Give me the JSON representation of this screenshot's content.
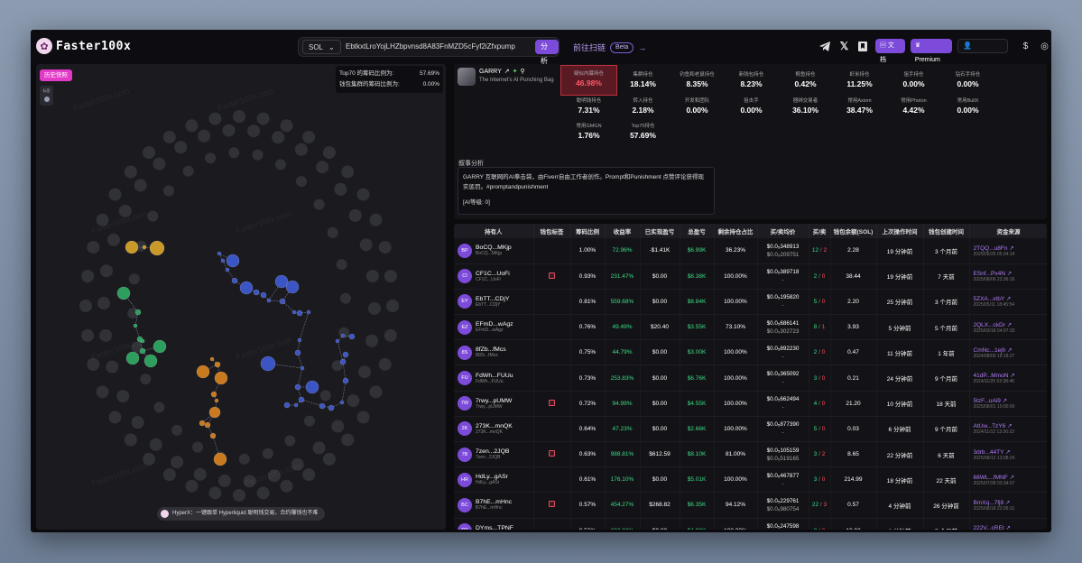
{
  "app": {
    "logo_text": "Faster100x"
  },
  "search": {
    "chain": "SOL",
    "address": "EbtkxtLroYojLHZbpvnsd8A83FnMZD5cFyf2iZfxpump",
    "analyze_label": "分析"
  },
  "scan": {
    "label": "前往扫链",
    "badge": "Beta",
    "arrow": "→"
  },
  "topbar": {
    "doc_label": "文档",
    "premium_label": "Premium"
  },
  "left": {
    "history_button": "历史快照",
    "side_chip_label": "标签",
    "top70_label": "Top70 的筹码比例为:",
    "top70_value": "57.69%",
    "wallet_cluster_label": "钱包集群的筹码比例为:",
    "wallet_cluster_value": "0.00%",
    "hyperx_text": "HyperX：一键跟单 Hyperliquid 聪明钱交易，合约赚钱也不难",
    "watermark": "Faster100x.com"
  },
  "token": {
    "name": "GARRY",
    "subtitle": "The Internet's AI Punching Bag"
  },
  "stats": [
    {
      "label": "疑似内幕持仓",
      "value": "46.98%"
    },
    {
      "label": "集群持仓",
      "value": "18.14%"
    },
    {
      "label": "钓鱼和老鼠持仓",
      "value": "8.35%"
    },
    {
      "label": "新钱包持仓",
      "value": "8.23%"
    },
    {
      "label": "鲸鱼持仓",
      "value": "0.42%"
    },
    {
      "label": "虾米持仓",
      "value": "11.25%"
    },
    {
      "label": "狙手持仓",
      "value": "0.00%"
    },
    {
      "label": "钻石手持仓",
      "value": "0.00%"
    },
    {
      "label": "聪明钱持仓",
      "value": "7.31%"
    },
    {
      "label": "转入持仓",
      "value": "2.18%"
    },
    {
      "label": "开发和团队",
      "value": "0.00%"
    },
    {
      "label": "狙击手",
      "value": "0.00%"
    },
    {
      "label": "捆绑交易者",
      "value": "36.10%"
    },
    {
      "label": "常用Axiom",
      "value": "38.47%"
    },
    {
      "label": "常用Photon",
      "value": "4.42%"
    },
    {
      "label": "常用BullX",
      "value": "0.00%"
    },
    {
      "label": "常用GMGN",
      "value": "1.76%"
    },
    {
      "label": "Top70持仓",
      "value": "57.69%"
    }
  ],
  "narrative": {
    "title": "叙事分析",
    "text": "GARRY 互联网的AI拳击袋，由Fiverr自由工作者创作。Prompt和Punishment 点赞评论获得现实惩罚。#promptandpunishment",
    "level": "[AI等级: 0]"
  },
  "table": {
    "headers": [
      "持有人",
      "钱包标签",
      "筹码比例",
      "收益率",
      "已实现盈亏",
      "总盈亏",
      "剩余持仓占比",
      "买/卖均价",
      "买/卖",
      "钱包余额(SOL)",
      "上次操作时间",
      "钱包创建时间",
      "资金来源"
    ],
    "rows": [
      {
        "av": "BP",
        "name": "BoCQ...MKjp",
        "sub": "BoCQ...MKjp",
        "tag": false,
        "ratio": "1.00%",
        "roi": "72.96%",
        "realized": "-$1.41K",
        "total": "$6.99K",
        "remain": "36.23%",
        "avg1": "$0.0₅348913",
        "avg2": "$0.0₅209751",
        "buy": "12",
        "sell": "2",
        "bal": "2.28",
        "last": "19 分钟前",
        "created": "3 个月前",
        "src": "2TQQ...u8Fn",
        "date": "2025/05/25 05:34:14"
      },
      {
        "av": "CI",
        "name": "CF1C...UoFi",
        "sub": "CF1C...UoFi",
        "tag": true,
        "ratio": "0.93%",
        "roi": "231.47%",
        "realized": "$0.00",
        "total": "$8.38K",
        "remain": "100.00%",
        "avg1": "$0.0₅389718",
        "avg2": "-",
        "buy": "2",
        "sell": "0",
        "bal": "38.44",
        "last": "19 分钟前",
        "created": "7 天前",
        "src": "ESnf...Px4N",
        "date": "2025/08/06 22:36:16"
      },
      {
        "av": "EY",
        "name": "EbTT...CDjY",
        "sub": "EbTT...CDjY",
        "tag": false,
        "ratio": "0.81%",
        "roi": "559.68%",
        "realized": "$0.00",
        "total": "$8.84K",
        "remain": "100.00%",
        "avg1": "$0.0₅195820",
        "avg2": "-",
        "buy": "5",
        "sell": "0",
        "bal": "2.20",
        "last": "25 分钟前",
        "created": "3 个月前",
        "src": "5ZXA...xtbY",
        "date": "2025/05/11 18:45:54"
      },
      {
        "av": "EZ",
        "name": "EFmD...wAgz",
        "sub": "EFmD...wAgz",
        "tag": false,
        "ratio": "0.76%",
        "roi": "49.49%",
        "realized": "$20.40",
        "total": "$3.55K",
        "remain": "73.10%",
        "avg1": "$0.0₅686141",
        "avg2": "$0.0₅302723",
        "buy": "8",
        "sell": "1",
        "bal": "3.93",
        "last": "5 分钟前",
        "created": "5 个月前",
        "src": "2QLX...ckDr",
        "date": "2025/03/18 04:07:33"
      },
      {
        "av": "8S",
        "name": "8fZb...fMcs",
        "sub": "8fZb...fMcs",
        "tag": false,
        "ratio": "0.75%",
        "roi": "44.79%",
        "realized": "$0.00",
        "total": "$3.00K",
        "remain": "100.00%",
        "avg1": "$0.0₅892230",
        "avg2": "-",
        "buy": "2",
        "sell": "0",
        "bal": "0.47",
        "last": "11 分钟前",
        "created": "1 年前",
        "src": "CmNc...1ejh",
        "date": "2024/08/09 18:18:27"
      },
      {
        "av": "FU",
        "name": "FdWh...FUUu",
        "sub": "FdWh...FUUu",
        "tag": false,
        "ratio": "0.73%",
        "roi": "253.83%",
        "realized": "$0.00",
        "total": "$6.76K",
        "remain": "100.00%",
        "avg1": "$0.0₅365092",
        "avg2": "-",
        "buy": "3",
        "sell": "0",
        "bal": "0.21",
        "last": "24 分钟前",
        "created": "9 个月前",
        "src": "41dP...MmoN",
        "date": "2024/11/25 02:38:46"
      },
      {
        "av": "7W",
        "name": "7rwy...pUMW",
        "sub": "7rwy...pUMW",
        "tag": true,
        "ratio": "0.72%",
        "roi": "94.99%",
        "realized": "$0.00",
        "total": "$4.55K",
        "remain": "100.00%",
        "avg1": "$0.0₅662494",
        "avg2": "-",
        "buy": "4",
        "sell": "0",
        "bal": "21.20",
        "last": "10 分钟前",
        "created": "18 天前",
        "src": "5tzF...uAi9",
        "date": "2025/08/01 10:00:00"
      },
      {
        "av": "2K",
        "name": "273K...mnQK",
        "sub": "273K...mnQK",
        "tag": false,
        "ratio": "0.64%",
        "roi": "47.23%",
        "realized": "$0.00",
        "total": "$2.66K",
        "remain": "100.00%",
        "avg1": "$0.0₅877390",
        "avg2": "-",
        "buy": "5",
        "sell": "0",
        "bal": "0.03",
        "last": "6 分钟前",
        "created": "9 个月前",
        "src": "AtUw...TzY6",
        "date": "2024/11/12 12:26:22"
      },
      {
        "av": "7B",
        "name": "7zen...2JQB",
        "sub": "7zen...2JQB",
        "tag": true,
        "ratio": "0.63%",
        "roi": "988.81%",
        "realized": "$612.59",
        "total": "$8.10K",
        "remain": "81.00%",
        "avg1": "$0.0₅105159",
        "avg2": "$0.0₅519165",
        "buy": "3",
        "sell": "2",
        "bal": "8.65",
        "last": "22 分钟前",
        "created": "6 天前",
        "src": "3drb...44TY",
        "date": "2025/08/12 13:08:24"
      },
      {
        "av": "HR",
        "name": "HdLy...gASr",
        "sub": "HdLy...gASr",
        "tag": false,
        "ratio": "0.61%",
        "roi": "176.10%",
        "realized": "$0.00",
        "total": "$5.01K",
        "remain": "100.00%",
        "avg1": "$0.0₅467877",
        "avg2": "-",
        "buy": "3",
        "sell": "0",
        "bal": "214.99",
        "last": "18 分钟前",
        "created": "22 天前",
        "src": "68WL...fMNF",
        "date": "2025/07/28 03:34:07"
      },
      {
        "av": "BC",
        "name": "B7hE...mHnc",
        "sub": "B7hE...mHnc",
        "tag": true,
        "ratio": "0.57%",
        "roi": "454.27%",
        "realized": "$268.82",
        "total": "$6.35K",
        "remain": "94.12%",
        "avg1": "$0.0₅229761",
        "avg2": "$0.0₅980754",
        "buy": "22",
        "sell": "3",
        "bal": "0.57",
        "last": "4 分钟前",
        "created": "26 分钟前",
        "src": "BmXq...7fj8",
        "date": "2025/08/18 22:05:31"
      },
      {
        "av": "DT",
        "name": "DYms...TPNF",
        "sub": "DYms...TPNF",
        "tag": false,
        "ratio": "0.56%",
        "roi": "332.82%",
        "realized": "$0.00",
        "total": "$4.98K",
        "remain": "100.00%",
        "avg1": "$0.0₅247598",
        "avg2": "-",
        "buy": "8",
        "sell": "0",
        "bal": "10.02",
        "last": "3 分钟前",
        "created": "7 个月前",
        "src": "222V...cREt",
        "date": "2025/01/14 09:10:00"
      }
    ]
  },
  "colors": {
    "accent": "#7c4bd9",
    "pink": "#e339c8",
    "green": "#3ddc84",
    "red": "#ff4d5d",
    "graph_blue": "#3c55c4",
    "graph_green": "#2e9e5e",
    "graph_orange": "#c97a1e",
    "graph_yellow": "#c9992a",
    "graph_gray": "#3a3a42"
  }
}
